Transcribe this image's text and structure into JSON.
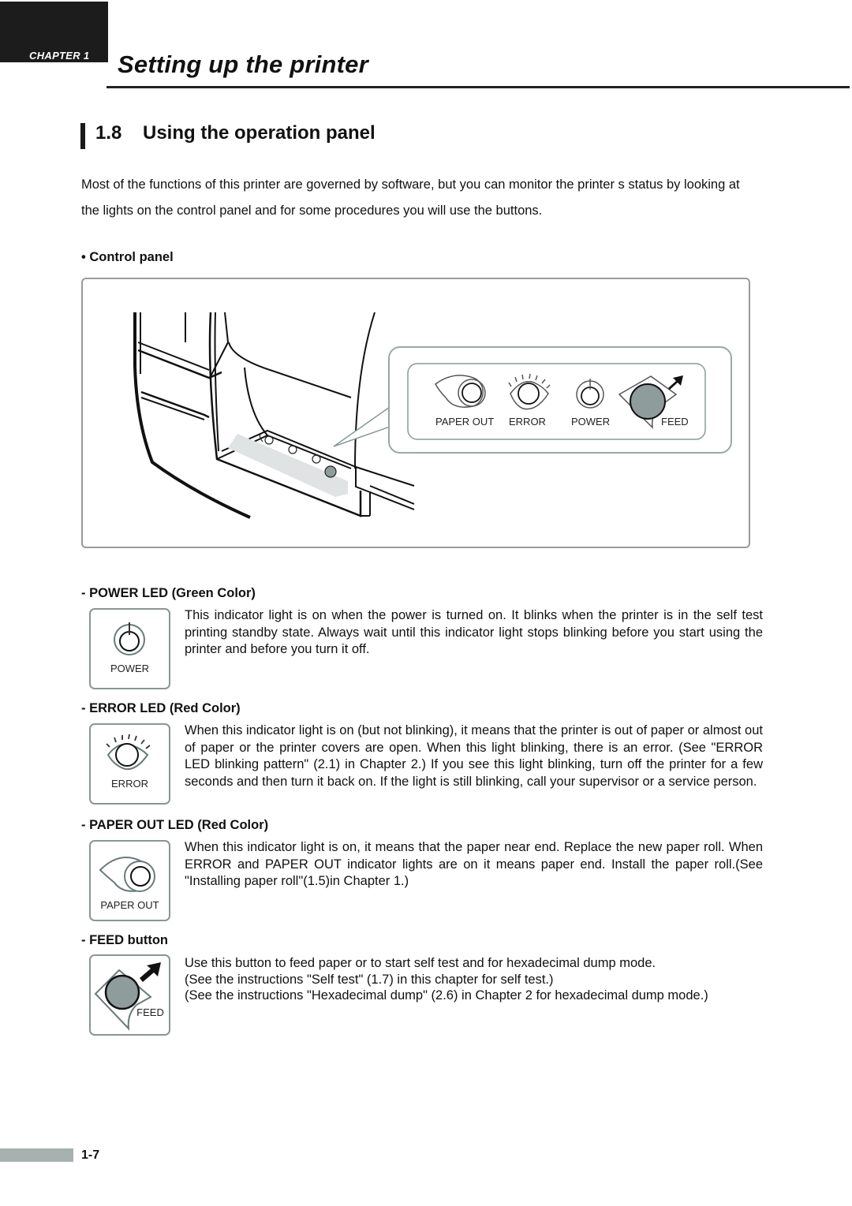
{
  "header": {
    "chapter_label": "CHAPTER 1",
    "page_title": "Setting up the printer"
  },
  "section": {
    "number": "1.8",
    "title": "Using the operation panel"
  },
  "intro": "Most of the functions of this printer are governed by software, but you can monitor the printer s status by looking at the lights on the control panel and for some procedures you will use the buttons.",
  "control_panel": {
    "label": "• Control panel",
    "figure_labels": {
      "paper_out": "PAPER OUT",
      "error": "ERROR",
      "power": "POWER",
      "feed": "FEED"
    },
    "feed_button_color": "#8f9c9c"
  },
  "items": [
    {
      "heading": "- POWER LED (Green Color)",
      "icon": "power-icon",
      "caption": "POWER",
      "text": "This indicator light is on when the power is turned on. It blinks when the printer is in the self test printing standby state. Always wait until this indicator light stops blinking before you start using the printer and before you turn it off."
    },
    {
      "heading": "- ERROR LED (Red Color)",
      "icon": "eye-icon",
      "caption": "ERROR",
      "text": "When this indicator light is on (but not blinking), it means that the printer is out of paper or almost out of paper or the printer covers are open. When this light blinking, there is an error. (See \"ERROR LED blinking pattern\" (2.1) in Chapter 2.) If you see this light blinking, turn off the printer for a few seconds and then turn it back on. If the light is still blinking, call your supervisor or a service person."
    },
    {
      "heading": "- PAPER OUT LED (Red Color)",
      "icon": "paper-roll-icon",
      "caption": "PAPER OUT",
      "text": "When this indicator light is on, it means that the paper near end. Replace the new paper roll. When ERROR and PAPER OUT indicator lights are on it means paper end. Install the paper roll.(See \"Installing paper roll\"(1.5)in Chapter 1.)"
    },
    {
      "heading": "- FEED button",
      "icon": "feed-button-icon",
      "caption": "FEED",
      "lines": [
        "Use this button to feed paper or to start self test and for hexadecimal dump mode.",
        "(See the instructions \"Self test\" (1.7) in this chapter for self test.)",
        "(See the instructions \"Hexadecimal dump\" (2.6) in Chapter 2 for hexadecimal dump mode.)"
      ]
    }
  ],
  "footer": {
    "page_number": "1-7"
  }
}
